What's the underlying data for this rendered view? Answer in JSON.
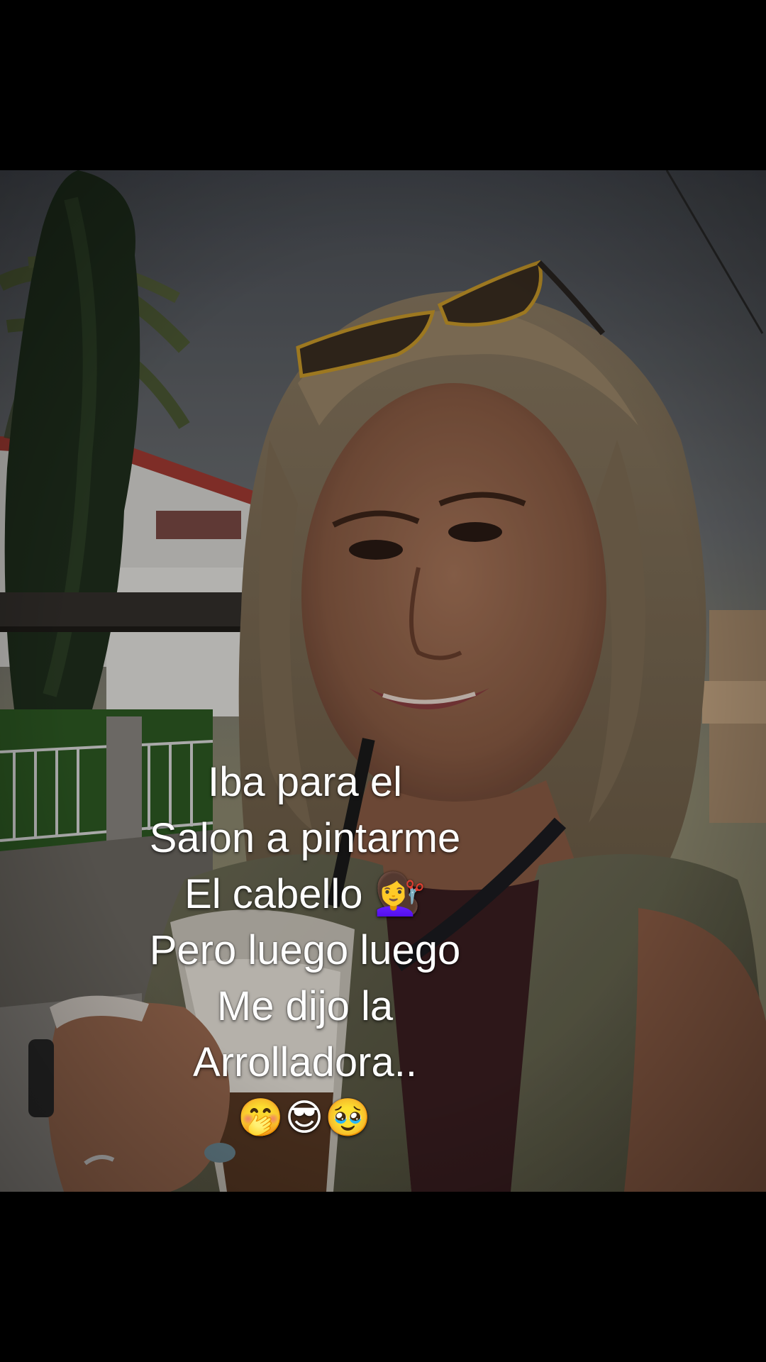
{
  "caption": {
    "lines": [
      "Iba para el",
      "Salon a pintarme",
      "El cabello 💇‍♀️",
      "Pero luego luego",
      "Me dijo la",
      "Arrolladora..",
      "🤭😎🥹"
    ]
  },
  "scene": {
    "description_icons": [
      "cypress-tree",
      "palm-tree",
      "white-house-red-roof",
      "railing",
      "iron-fence",
      "lawn",
      "sunglasses",
      "iced-coffee-cup",
      "smartwatch"
    ]
  }
}
